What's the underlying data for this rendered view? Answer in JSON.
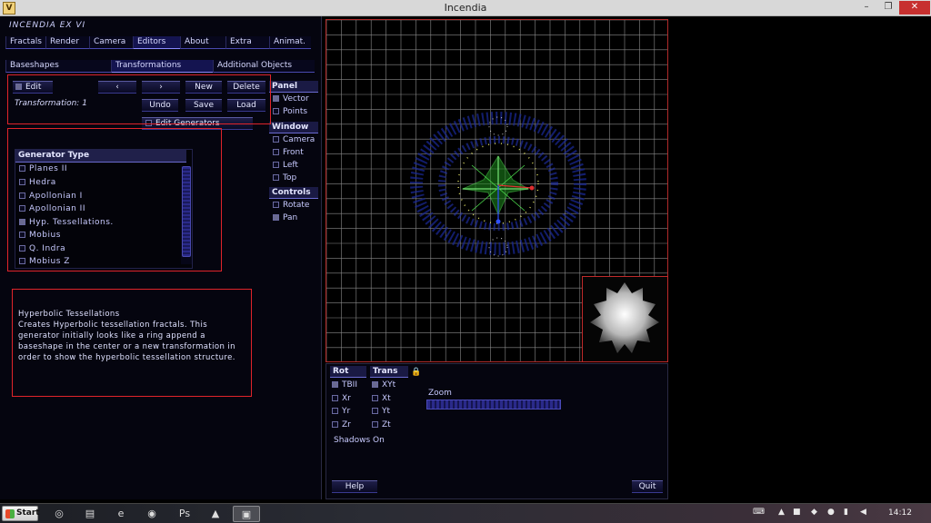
{
  "window": {
    "title": "Incendia",
    "minimize_glyph": "–",
    "maximize_glyph": "❐",
    "close_glyph": "✕",
    "app_icon_glyph": "V"
  },
  "app": {
    "name": "INCENDIA EX VI",
    "main_tabs": [
      "Fractals",
      "Render",
      "Camera",
      "Editors",
      "About",
      "Extra",
      "Animat."
    ],
    "active_main_tab": "Editors",
    "sub_tabs": [
      "Baseshapes",
      "Transformations",
      "Additional Objects"
    ],
    "active_sub_tab": "Transformations"
  },
  "transform_toolbar": {
    "edit_label": "Edit",
    "prev_label": "‹",
    "next_label": "›",
    "new_label": "New",
    "delete_label": "Delete",
    "transformation_text": "Transformation: 1",
    "undo_label": "Undo",
    "save_label": "Save",
    "load_label": "Load",
    "edit_generators_label": "Edit Generators"
  },
  "generator_list": {
    "header": "Generator Type",
    "items": [
      {
        "label": "Planes II",
        "checked": false
      },
      {
        "label": "Hedra",
        "checked": false
      },
      {
        "label": "Apollonian I",
        "checked": false
      },
      {
        "label": "Apollonian II",
        "checked": false
      },
      {
        "label": "Hyp. Tessellations.",
        "checked": true
      },
      {
        "label": "Mobius",
        "checked": false
      },
      {
        "label": "Q. Indra",
        "checked": false
      },
      {
        "label": "Mobius Z",
        "checked": false
      }
    ]
  },
  "description": {
    "title": "Hyperbolic Tessellations",
    "body": "Creates Hyperbolic tessellation  fractals. This generator initially looks like a ring append a  baseshape in the center or a new transformation in order to show the hyperbolic tessellation structure."
  },
  "panel_group": {
    "header": "Panel",
    "items": [
      {
        "label": "Vector",
        "checked": true
      },
      {
        "label": "Points",
        "checked": false
      }
    ]
  },
  "window_group": {
    "header": "Window",
    "items": [
      {
        "label": "Camera",
        "checked": false
      },
      {
        "label": "Front",
        "checked": false
      },
      {
        "label": "Left",
        "checked": false
      },
      {
        "label": "Top",
        "checked": false
      }
    ]
  },
  "controls_group": {
    "header": "Controls",
    "items": [
      {
        "label": "Rotate",
        "checked": false
      },
      {
        "label": "Pan",
        "checked": true
      }
    ]
  },
  "bottom_controls": {
    "rot_header": "Rot",
    "rot_items": [
      {
        "label": "TBII",
        "checked": true
      },
      {
        "label": "Xr",
        "checked": false
      },
      {
        "label": "Yr",
        "checked": false
      },
      {
        "label": "Zr",
        "checked": false
      }
    ],
    "trans_header": "Trans",
    "trans_items": [
      {
        "label": "XYt",
        "checked": true
      },
      {
        "label": "Xt",
        "checked": false
      },
      {
        "label": "Yt",
        "checked": false
      },
      {
        "label": "Zt",
        "checked": false
      }
    ],
    "lock_glyph": "🔒",
    "zoom_label": "Zoom",
    "shadows_text": "Shadows On",
    "help_label": "Help",
    "quit_label": "Quit"
  },
  "taskbar": {
    "start_label": "Start",
    "apps": [
      {
        "icon": "chrome-icon",
        "glyph": "◎"
      },
      {
        "icon": "folder-icon",
        "glyph": "▤"
      },
      {
        "icon": "internet-explorer-icon",
        "glyph": "e"
      },
      {
        "icon": "firefox-icon",
        "glyph": "◉"
      },
      {
        "icon": "photoshop-icon",
        "glyph": "Ps"
      },
      {
        "icon": "paint-icon",
        "glyph": "▲"
      },
      {
        "icon": "incendia-icon",
        "glyph": "▣"
      }
    ],
    "clock": "14:12"
  },
  "colors": {
    "accent_red": "#e0242a",
    "panel_bg": "#05050f",
    "grid_line": "#8a8a8a"
  }
}
